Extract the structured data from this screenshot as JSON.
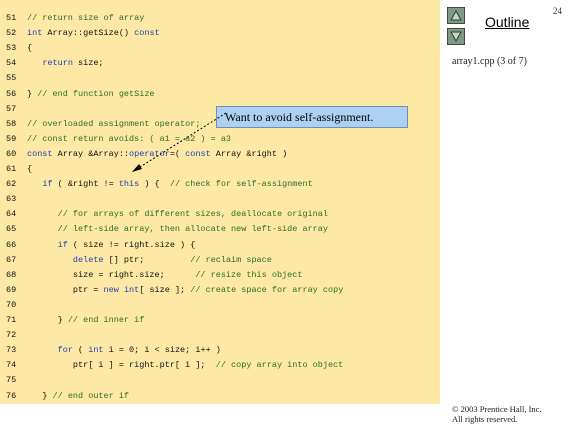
{
  "slide": {
    "number": "24",
    "outline_label": "Outline",
    "filename": "array1.cpp (3 of 7)",
    "copyright_line1": "© 2003 Prentice Hall, Inc.",
    "copyright_line2": "All rights reserved."
  },
  "callout": {
    "text": "Want to avoid self-assignment."
  },
  "nav": {
    "up_icon": "triangle-up-icon",
    "down_icon": "triangle-down-icon"
  },
  "code": [
    {
      "num": "51",
      "parts": [
        {
          "t": "// return size of array",
          "c": "cm"
        }
      ]
    },
    {
      "num": "52",
      "parts": [
        {
          "t": "int",
          "c": "kw"
        },
        {
          "t": " Array::getSize() ",
          "c": ""
        },
        {
          "t": "const",
          "c": "kw"
        }
      ]
    },
    {
      "num": "53",
      "parts": [
        {
          "t": "{",
          "c": ""
        }
      ]
    },
    {
      "num": "54",
      "parts": [
        {
          "t": "   ",
          "c": ""
        },
        {
          "t": "return",
          "c": "kw"
        },
        {
          "t": " size;",
          "c": ""
        }
      ]
    },
    {
      "num": "55",
      "parts": [
        {
          "t": "",
          "c": ""
        }
      ]
    },
    {
      "num": "56",
      "parts": [
        {
          "t": "} ",
          "c": ""
        },
        {
          "t": "// end function getSize",
          "c": "cm"
        }
      ]
    },
    {
      "num": "57",
      "parts": [
        {
          "t": "",
          "c": ""
        }
      ]
    },
    {
      "num": "58",
      "parts": [
        {
          "t": "// overloaded assignment operator;",
          "c": "cm"
        }
      ]
    },
    {
      "num": "59",
      "parts": [
        {
          "t": "// const return avoids: ( a1 = a2 ) = a3",
          "c": "cm"
        }
      ]
    },
    {
      "num": "60",
      "parts": [
        {
          "t": "const",
          "c": "kw"
        },
        {
          "t": " Array &Array::",
          "c": ""
        },
        {
          "t": "operator",
          "c": "kw"
        },
        {
          "t": "=( ",
          "c": ""
        },
        {
          "t": "const",
          "c": "kw"
        },
        {
          "t": " Array &right )",
          "c": ""
        }
      ]
    },
    {
      "num": "61",
      "parts": [
        {
          "t": "{",
          "c": ""
        }
      ]
    },
    {
      "num": "62",
      "parts": [
        {
          "t": "   ",
          "c": ""
        },
        {
          "t": "if",
          "c": "kw"
        },
        {
          "t": " ( &right != ",
          "c": ""
        },
        {
          "t": "this",
          "c": "kw"
        },
        {
          "t": " ) {  ",
          "c": ""
        },
        {
          "t": "// check for self-assignment",
          "c": "cm"
        }
      ]
    },
    {
      "num": "63",
      "parts": [
        {
          "t": "",
          "c": ""
        }
      ]
    },
    {
      "num": "64",
      "parts": [
        {
          "t": "      ",
          "c": ""
        },
        {
          "t": "// for arrays of different sizes, deallocate original",
          "c": "cm"
        }
      ]
    },
    {
      "num": "65",
      "parts": [
        {
          "t": "      ",
          "c": ""
        },
        {
          "t": "// left-side array, then allocate new left-side array",
          "c": "cm"
        }
      ]
    },
    {
      "num": "66",
      "parts": [
        {
          "t": "      ",
          "c": ""
        },
        {
          "t": "if",
          "c": "kw"
        },
        {
          "t": " ( size != right.size ) {",
          "c": ""
        }
      ]
    },
    {
      "num": "67",
      "parts": [
        {
          "t": "         ",
          "c": ""
        },
        {
          "t": "delete",
          "c": "kw"
        },
        {
          "t": " [] ptr;         ",
          "c": ""
        },
        {
          "t": "// reclaim space",
          "c": "cm"
        }
      ]
    },
    {
      "num": "68",
      "parts": [
        {
          "t": "         size = right.size;      ",
          "c": ""
        },
        {
          "t": "// resize this object",
          "c": "cm"
        }
      ]
    },
    {
      "num": "69",
      "parts": [
        {
          "t": "         ptr = ",
          "c": ""
        },
        {
          "t": "new",
          "c": "kw"
        },
        {
          "t": " ",
          "c": ""
        },
        {
          "t": "int",
          "c": "kw"
        },
        {
          "t": "[ size ]; ",
          "c": ""
        },
        {
          "t": "// create space for array copy",
          "c": "cm"
        }
      ]
    },
    {
      "num": "70",
      "parts": [
        {
          "t": "",
          "c": ""
        }
      ]
    },
    {
      "num": "71",
      "parts": [
        {
          "t": "      } ",
          "c": ""
        },
        {
          "t": "// end inner if",
          "c": "cm"
        }
      ]
    },
    {
      "num": "72",
      "parts": [
        {
          "t": "",
          "c": ""
        }
      ]
    },
    {
      "num": "73",
      "parts": [
        {
          "t": "      ",
          "c": ""
        },
        {
          "t": "for",
          "c": "kw"
        },
        {
          "t": " ( ",
          "c": ""
        },
        {
          "t": "int",
          "c": "kw"
        },
        {
          "t": " i = 0; i < size; i++ )",
          "c": ""
        }
      ]
    },
    {
      "num": "74",
      "parts": [
        {
          "t": "         ptr[ i ] = right.ptr[ i ];  ",
          "c": ""
        },
        {
          "t": "// copy array into object",
          "c": "cm"
        }
      ]
    },
    {
      "num": "75",
      "parts": [
        {
          "t": "",
          "c": ""
        }
      ]
    },
    {
      "num": "76",
      "parts": [
        {
          "t": "   } ",
          "c": ""
        },
        {
          "t": "// end outer if",
          "c": "cm"
        }
      ]
    }
  ]
}
